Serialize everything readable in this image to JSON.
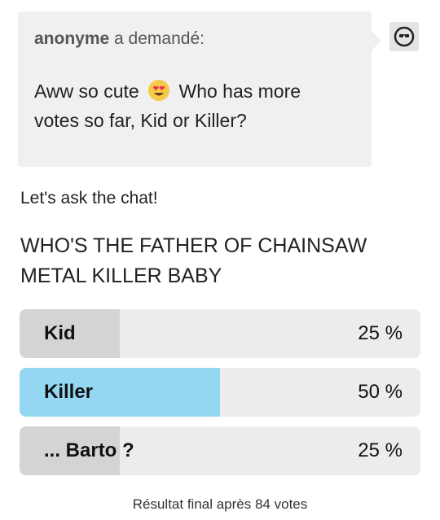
{
  "ask": {
    "asker_name": "anonyme",
    "asked_suffix": "a demandé:",
    "question_before_emoji": "Aww so cute",
    "question_emoji": "heart-eyes-emoji",
    "question_after_emoji": "Who has more votes so far, Kid or Killer?"
  },
  "avatar": {
    "icon": "sunglasses-avatar-icon"
  },
  "answer": {
    "text": "Let's ask the chat!"
  },
  "poll": {
    "title": "WHO'S THE FATHER OF CHAINSAW METAL KILLER BABY",
    "options": [
      {
        "label": "Kid",
        "percent_text": "25 %",
        "share": 0.25,
        "fill_color": "#d4d4d4"
      },
      {
        "label": "Killer",
        "percent_text": "50 %",
        "share": 0.5,
        "fill_color": "#94d7f2"
      },
      {
        "label": "... Barto ?",
        "percent_text": "25 %",
        "share": 0.25,
        "fill_color": "#d4d4d4"
      }
    ],
    "footer": "Résultat final après 84 votes"
  },
  "colors": {
    "bubble_bg": "#f0f0f0",
    "option_bg": "#ececec",
    "winner_fill": "#94d7f2"
  }
}
